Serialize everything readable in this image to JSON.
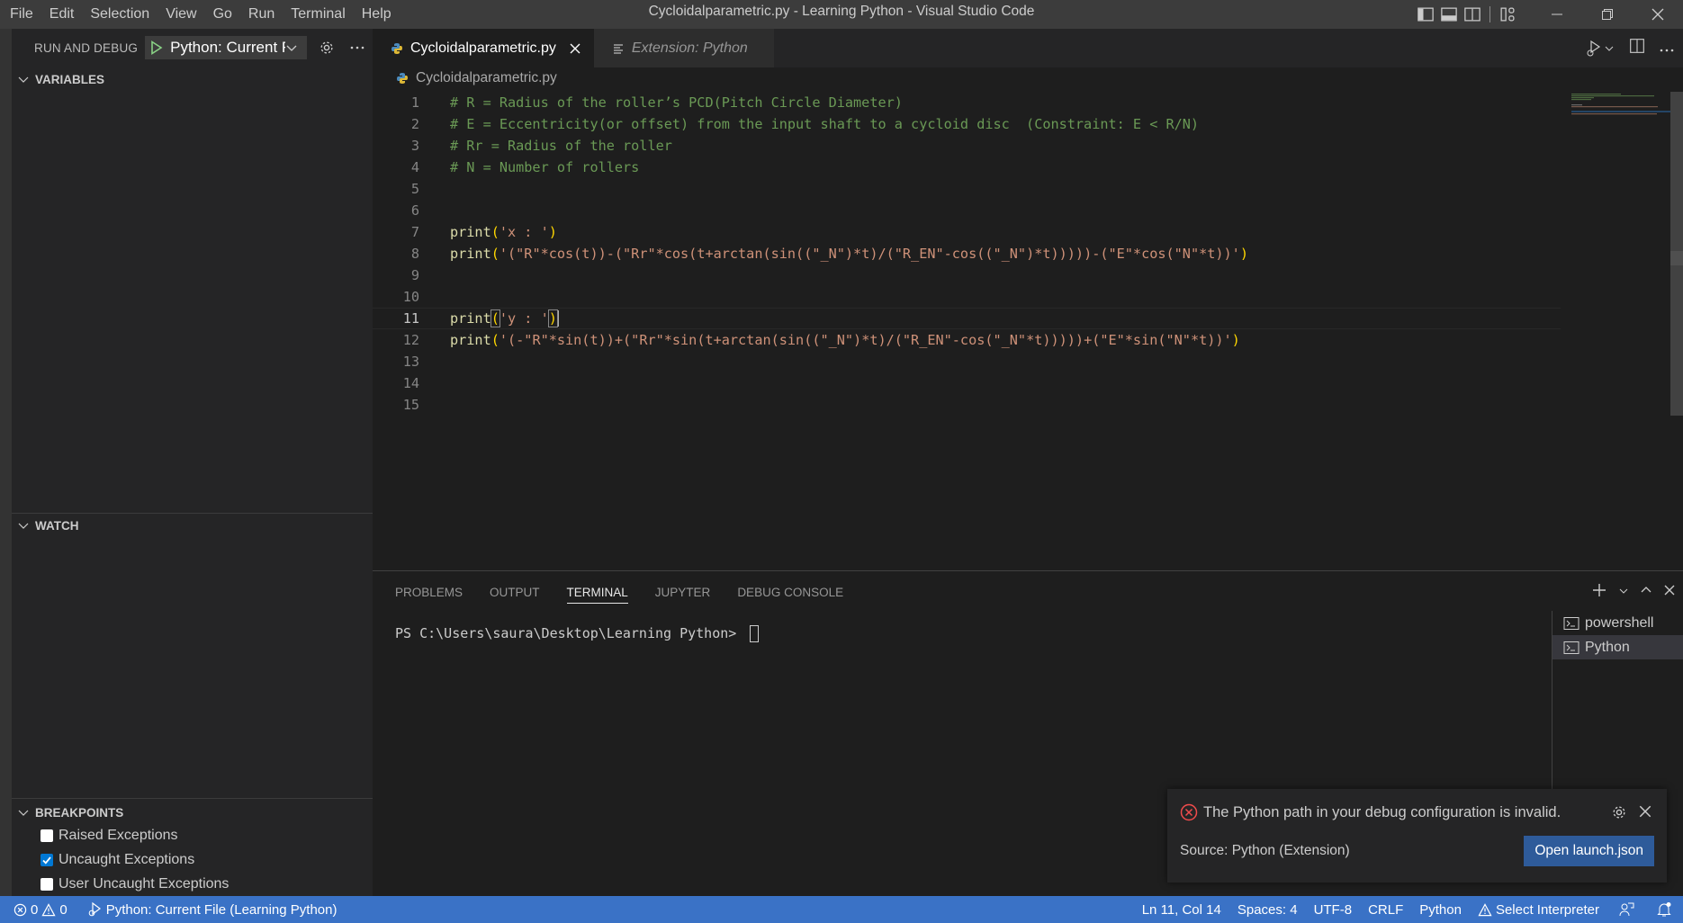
{
  "titlebar": {
    "menu": [
      "File",
      "Edit",
      "Selection",
      "View",
      "Go",
      "Run",
      "Terminal",
      "Help"
    ],
    "window_title": "Cycloidalparametric.py - Learning Python - Visual Studio Code"
  },
  "sidebar": {
    "title": "RUN AND DEBUG",
    "config_name": "Python: Current File",
    "sections": {
      "variables": "VARIABLES",
      "watch": "WATCH",
      "breakpoints": "BREAKPOINTS"
    },
    "breakpoints": [
      {
        "label": "Raised Exceptions",
        "checked": false
      },
      {
        "label": "Uncaught Exceptions",
        "checked": true
      },
      {
        "label": "User Uncaught Exceptions",
        "checked": false
      }
    ]
  },
  "editor": {
    "tabs": [
      {
        "label": "Cycloidalparametric.py",
        "active": true
      },
      {
        "label": "Extension: Python",
        "active": false
      }
    ],
    "breadcrumb": "Cycloidalparametric.py",
    "current_line": 11,
    "lines": [
      {
        "n": "1",
        "text": "# R = Radius of the roller’s PCD(Pitch Circle Diameter)"
      },
      {
        "n": "2",
        "text": "# E = Eccentricity(or offset) from the input shaft to a cycloid disc  (Constraint: E < R/N)"
      },
      {
        "n": "3",
        "text": "# Rr = Radius of the roller"
      },
      {
        "n": "4",
        "text": "# N = Number of rollers"
      },
      {
        "n": "5",
        "text": ""
      },
      {
        "n": "6",
        "text": ""
      },
      {
        "n": "7",
        "text": "print('x : ')"
      },
      {
        "n": "8",
        "text": "print('(\"R\"*cos(t))-(\"Rr\"*cos(t+arctan(sin((\"_N\")*t)/(\"R_EN\"-cos((\"_N\")*t)))))-(\"E\"*cos(\"N\"*t))')"
      },
      {
        "n": "9",
        "text": ""
      },
      {
        "n": "10",
        "text": ""
      },
      {
        "n": "11",
        "text": "print('y : ')"
      },
      {
        "n": "12",
        "text": "print('(-\"R\"*sin(t))+(\"Rr\"*sin(t+arctan(sin((\"_N\")*t)/(\"R_EN\"-cos(\"_N\"*t)))))+(\"E\"*sin(\"N\"*t))')"
      },
      {
        "n": "13",
        "text": ""
      },
      {
        "n": "14",
        "text": ""
      },
      {
        "n": "15",
        "text": ""
      }
    ]
  },
  "panel": {
    "tabs": [
      "PROBLEMS",
      "OUTPUT",
      "TERMINAL",
      "JUPYTER",
      "DEBUG CONSOLE"
    ],
    "active_tab": "TERMINAL",
    "terminal_prompt": "PS C:\\Users\\saura\\Desktop\\Learning Python> ",
    "terminals": [
      {
        "label": "powershell",
        "selected": false
      },
      {
        "label": "Python",
        "selected": true
      }
    ]
  },
  "notification": {
    "message": "The Python path in your debug configuration is invalid.",
    "source": "Source: Python (Extension)",
    "button": "Open launch.json"
  },
  "statusbar": {
    "errors": "0",
    "warnings": "0",
    "debug_config": "Python: Current File (Learning Python)",
    "position": "Ln 11, Col 14",
    "spaces": "Spaces: 4",
    "encoding": "UTF-8",
    "eol": "CRLF",
    "language": "Python",
    "interpreter": "Select Interpreter"
  },
  "colors": {
    "statusbar": "#3a72c6",
    "comment": "#6a9955",
    "string": "#ce9178",
    "function": "#dcdcaa",
    "bracket": "#ffd700",
    "button": "#2e5b9a",
    "error": "#f14c4c"
  }
}
